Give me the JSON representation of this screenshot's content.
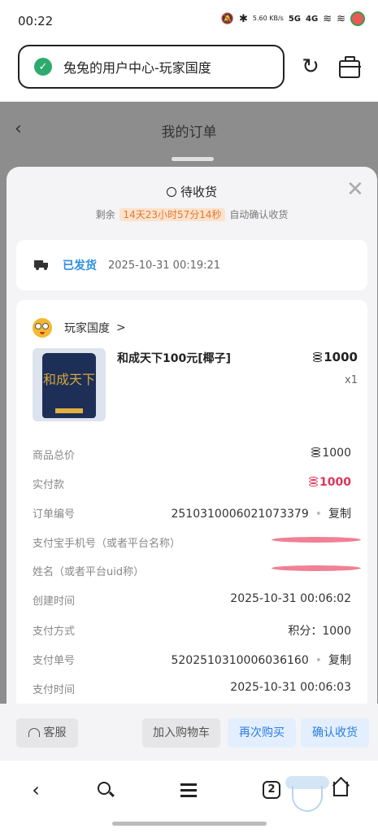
{
  "status_bar": {
    "time": "00:22",
    "net_speed": "5.60\nKB/s",
    "sig1": "5G",
    "sig2": "4G"
  },
  "browser": {
    "url": "兔兔的用户中心-玩家国度"
  },
  "page": {
    "title": "我的订单",
    "back": "‹"
  },
  "order": {
    "status": "待收货",
    "countdown_prefix": "剩余",
    "countdown": "14天23小时57分14秒",
    "countdown_suffix": "自动确认收货",
    "shipping_status": "已发货",
    "shipping_time": "2025-10-31 00:19:21",
    "shop_name": "玩家国度",
    "product": {
      "name": "和成天下100元[椰子]",
      "price": "1000",
      "qty": "x1",
      "image_text": "和成天下"
    },
    "details": [
      {
        "label": "商品总价",
        "value": "1000",
        "coin": true
      },
      {
        "label": "实付款",
        "value": "1000",
        "coin": true,
        "highlight": true
      },
      {
        "label": "订单编号",
        "value": "2510310006021073379",
        "copy": "复制"
      },
      {
        "label": "支付宝手机号（或者平台名称）",
        "value": "",
        "redacted": true
      },
      {
        "label": "姓名（或者平台uid称）",
        "value": "",
        "redacted": true
      },
      {
        "label": "创建时间",
        "value": "2025-10-31 00:06:02"
      },
      {
        "label": "支付方式",
        "value": "积分：1000"
      },
      {
        "label": "支付单号",
        "value": "5202510310006036160",
        "copy": "复制"
      },
      {
        "label": "支付时间",
        "value": "2025-10-31 00:06:03"
      }
    ]
  },
  "actions": {
    "service": "客服",
    "add_cart": "加入购物车",
    "rebuy": "再次购买",
    "confirm": "确认收货"
  },
  "nav": {
    "tab_count": "2"
  },
  "colors": {
    "accent_blue": "#2a8ee0",
    "price_red": "#e0345a",
    "countdown_orange": "#e07a30",
    "secure_green": "#2eaa6e"
  }
}
